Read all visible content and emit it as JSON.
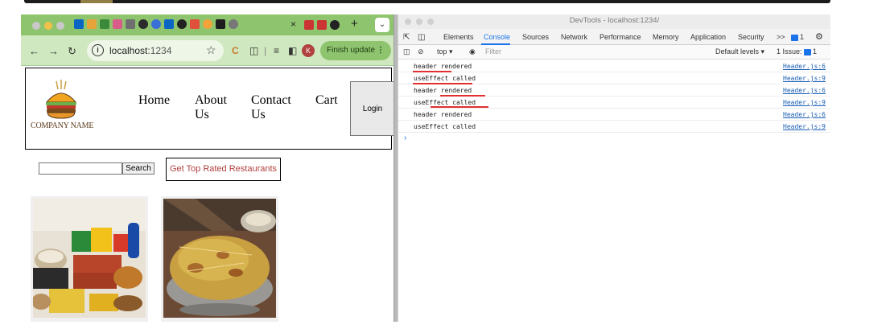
{
  "browser": {
    "address": {
      "host": "localhost",
      "port": ":1234"
    },
    "finish_update": "Finish update",
    "avatar_initial": "K",
    "tab_close": "×",
    "new_tab": "+"
  },
  "app": {
    "company_name": "COMPANY NAME",
    "nav": [
      {
        "label": "Home"
      },
      {
        "label": "About Us"
      },
      {
        "label": "Contact Us"
      },
      {
        "label": "Cart"
      }
    ],
    "login_label": "Login",
    "search_button": "Search",
    "search_placeholder": "",
    "top_rated_button": "Get Top Rated Restaurants",
    "cards": [
      {
        "name": "food-combo-image"
      },
      {
        "name": "biryani-image"
      }
    ]
  },
  "devtools": {
    "title": "DevTools - localhost:1234/",
    "tabs": [
      "Elements",
      "Console",
      "Sources",
      "Network",
      "Performance",
      "Memory",
      "Application",
      "Security"
    ],
    "active_tab": "Console",
    "more": ">>",
    "issue_badge_count": "1",
    "context": "top ▾",
    "filter_placeholder": "Filter",
    "default_levels": "Default levels ▾",
    "issues_label": "1 Issue:",
    "issues_count": "1",
    "logs": [
      {
        "message": "header rendered",
        "source": "Header.js:6"
      },
      {
        "message": "useEffect called",
        "source": "Header.js:9"
      },
      {
        "message": "header rendered",
        "source": "Header.js:6"
      },
      {
        "message": "useEffect called",
        "source": "Header.js:9"
      },
      {
        "message": "header rendered",
        "source": "Header.js:6"
      },
      {
        "message": "useEffect called",
        "source": "Header.js:9"
      }
    ],
    "prompt": "›"
  },
  "colors": {
    "tabbar": "#8fc46f",
    "addrbar": "#cfe8bf",
    "accent_red": "#b0413e",
    "devtools_blue": "#1a73e8",
    "annotation_red": "#e03030"
  }
}
